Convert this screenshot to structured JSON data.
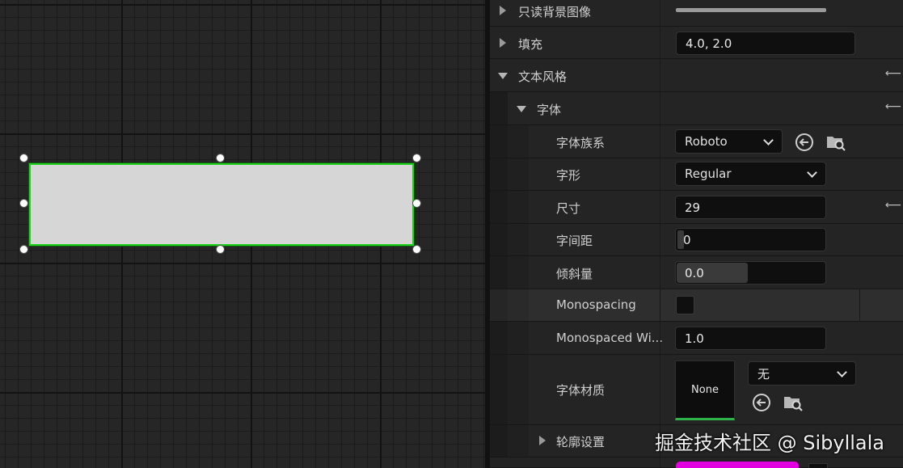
{
  "details": {
    "readonly_bg_label": "只读背景图像",
    "padding": {
      "label": "填充",
      "value": "4.0, 2.0"
    },
    "text_style_label": "文本风格",
    "font_label": "字体",
    "font_family": {
      "label": "字体族系",
      "value": "Roboto"
    },
    "typeface": {
      "label": "字形",
      "value": "Regular"
    },
    "size": {
      "label": "尺寸",
      "value": "29"
    },
    "letter_spacing": {
      "label": "字间距",
      "value": "0"
    },
    "skew": {
      "label": "倾斜量",
      "value": "0.0"
    },
    "monospacing": {
      "label": "Monospacing"
    },
    "monospaced_width": {
      "label": "Monospaced Wi...",
      "value": "1.0"
    },
    "font_material": {
      "label": "字体材质",
      "thumb": "None",
      "value": "无"
    },
    "outline_label": "轮廓设置",
    "reset_glyph": "⟵"
  },
  "watermark": "掘金技术社区 @ Sibyllala",
  "colors": {
    "selection": "#1ed21e",
    "magenta_swatch": "#e000e0"
  },
  "icons": [
    "reset-arrow-icon",
    "browse-folder-icon",
    "expand-arrow-icon",
    "collapse-arrow-icon",
    "chevron-down-icon"
  ]
}
